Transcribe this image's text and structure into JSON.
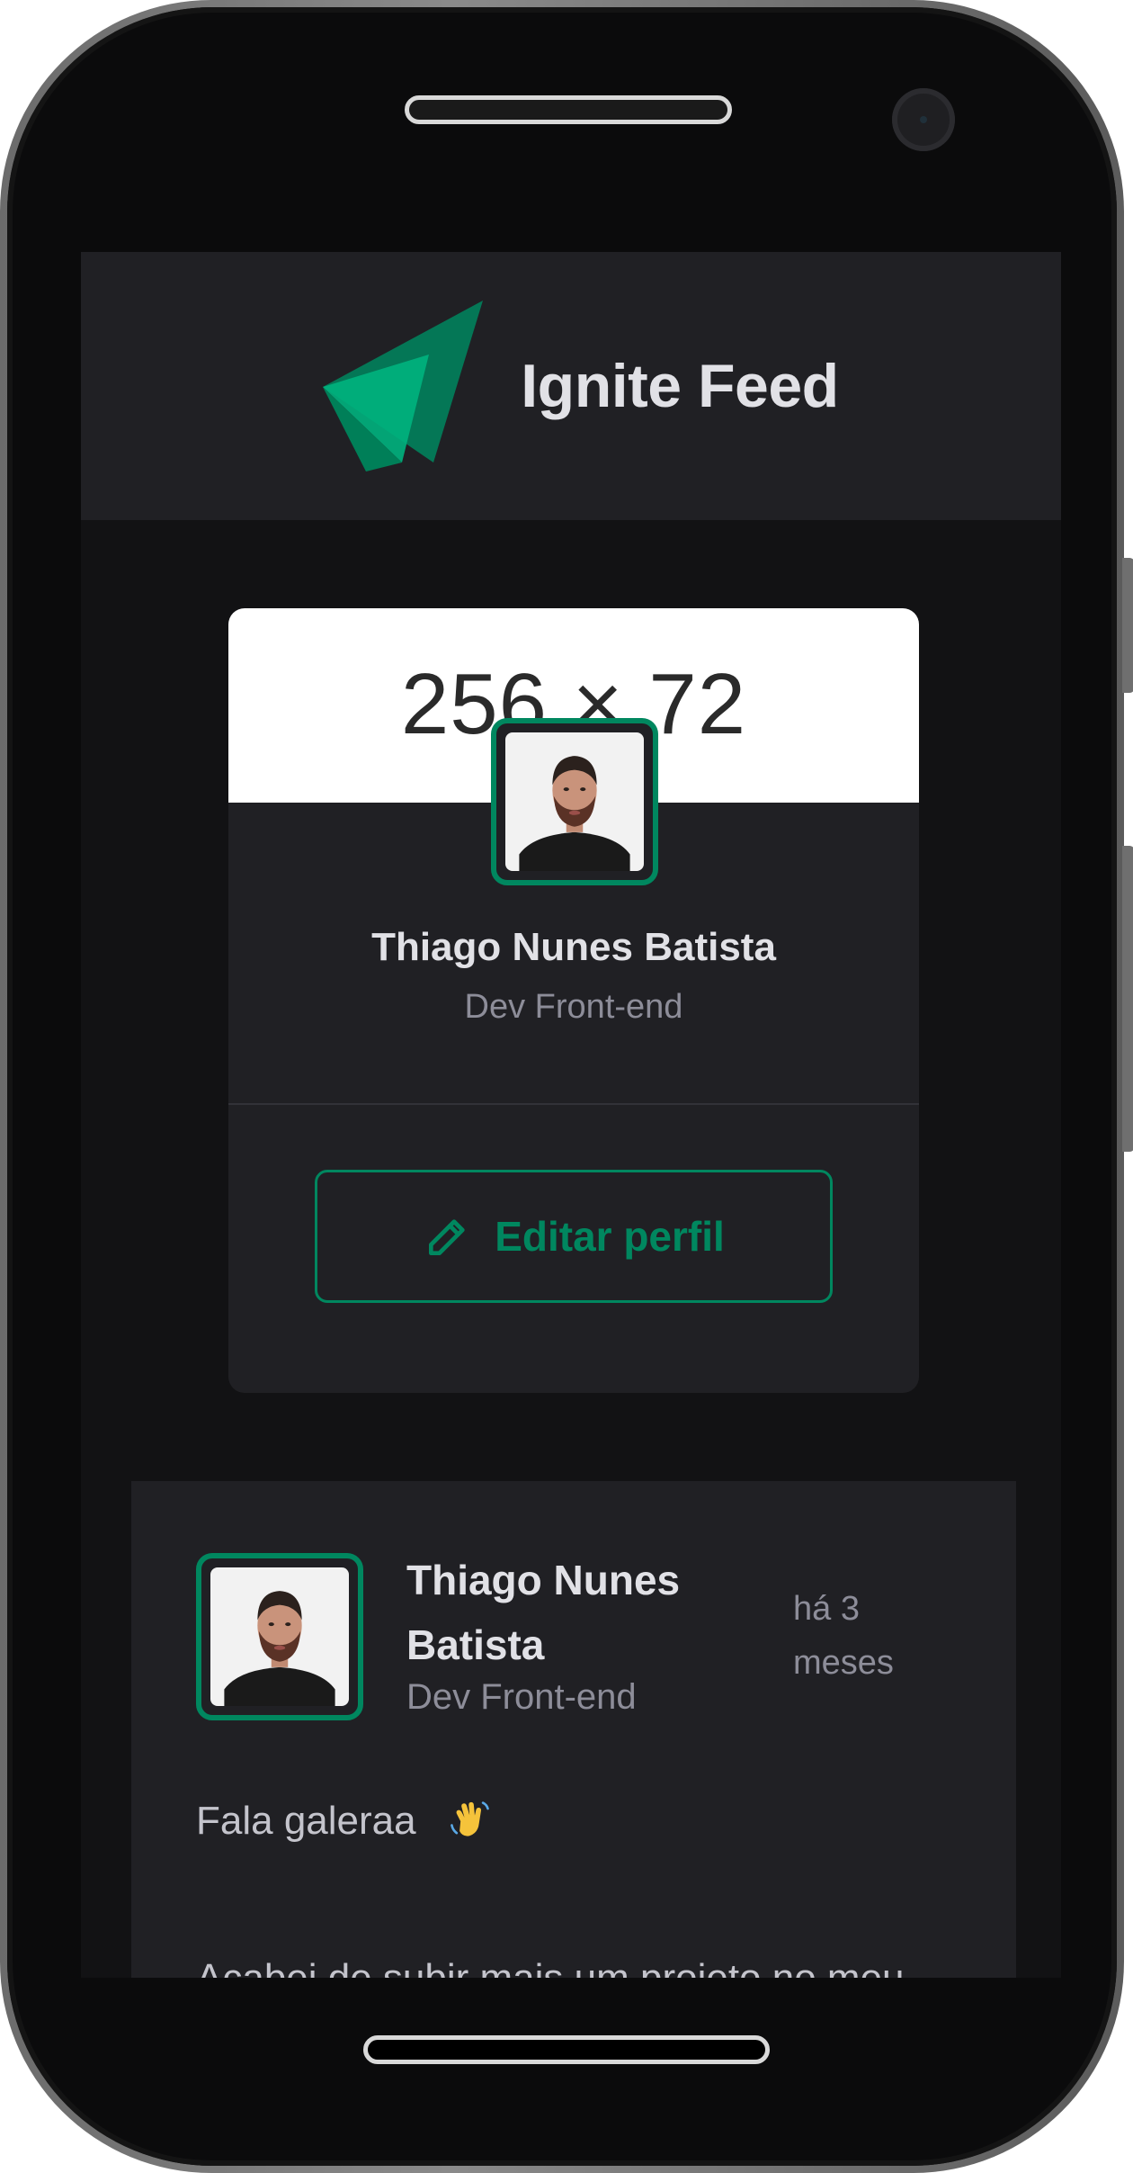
{
  "app": {
    "title": "Ignite Feed"
  },
  "profile": {
    "cover_placeholder": "256 × 72",
    "name": "Thiago Nunes Batista",
    "role": "Dev Front-end",
    "edit_button_label": "Editar perfil"
  },
  "post": {
    "author": "Thiago Nunes Batista",
    "role": "Dev Front-end",
    "time": "há 3 meses",
    "greeting": "Fala galeraa",
    "body": "Acabei de subir mais um projeto no meu portifólio. É um projeto que fiz"
  },
  "icons": {
    "logo": "ignite-logo-icon",
    "edit": "pencil-icon",
    "wave": "waving-hand-emoji"
  },
  "colors": {
    "accent": "#00875F",
    "background": "#121214",
    "surface": "#202024",
    "title": "#E1E1E6",
    "muted": "#8D8D99"
  }
}
